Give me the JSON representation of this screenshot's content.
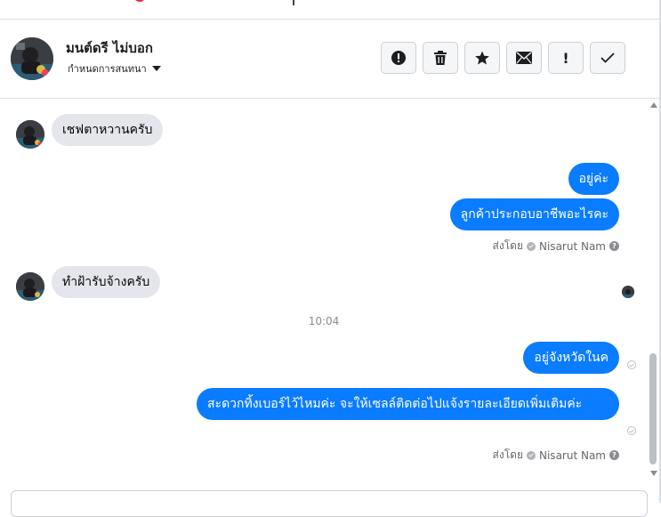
{
  "header": {
    "contact_name": "มนต์ดรี ไม่บอก",
    "conversation_label": "กำหนดการสนทนา"
  },
  "toolbar": {
    "buttons": [
      {
        "name": "report-button",
        "icon": "alert-circle-icon"
      },
      {
        "name": "delete-button",
        "icon": "trash-icon"
      },
      {
        "name": "star-button",
        "icon": "star-icon"
      },
      {
        "name": "mark-unread-button",
        "icon": "envelope-icon"
      },
      {
        "name": "important-button",
        "icon": "exclamation-icon",
        "glyph": "!"
      },
      {
        "name": "done-button",
        "icon": "check-icon"
      }
    ]
  },
  "messages": [
    {
      "direction": "in",
      "text": "เชฟตาหวานครับ"
    },
    {
      "direction": "out",
      "text": "อยู่ค่ะ"
    },
    {
      "direction": "out",
      "text": "ลูกค้าประกอบอาชีพอะไรคะ"
    },
    {
      "direction": "in",
      "text": "ทำฝ้ารับจ้างครับ"
    },
    {
      "direction": "out",
      "text": "อยู่จังหวัดในค"
    },
    {
      "direction": "out",
      "text": "สะดวกทิ้งเบอร์ไว้ไหมค่ะ จะให้เซลล์ติดต่อไปแจ้งรายละเอียดเพิ่มเติมค่ะ"
    }
  ],
  "sent_by": {
    "prefix": "ส่งโดย",
    "name": "Nisarut Nam",
    "help_glyph": "?"
  },
  "time_separator": "10:04",
  "colors": {
    "outgoing_bubble": "#0a7cff",
    "incoming_bubble": "#e4e6eb",
    "notification_red": "#f02849"
  }
}
